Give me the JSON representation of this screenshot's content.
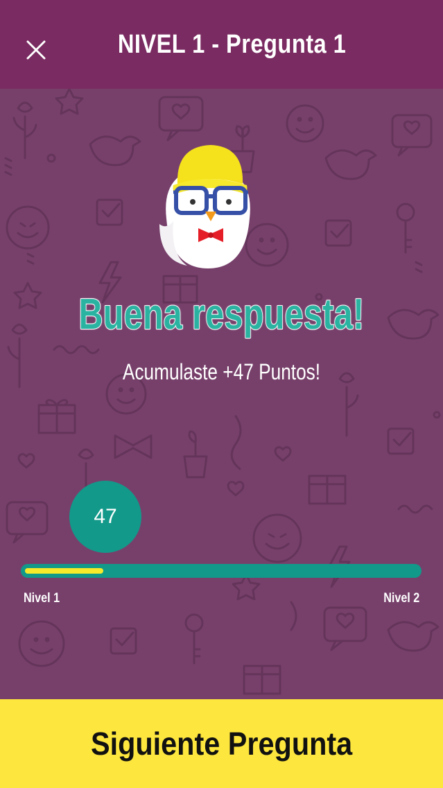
{
  "header": {
    "title": "NIVEL 1 - Pregunta 1",
    "close_icon": "close-icon"
  },
  "result": {
    "headline": "Buena respuesta!",
    "points_message": "Acumulaste +47 Puntos!",
    "mascot_icon": "chick-mascot-icon"
  },
  "progress": {
    "score": "47",
    "fill_fraction": 0.2,
    "current_level_label": "Nivel 1",
    "next_level_label": "Nivel 2"
  },
  "footer": {
    "next_button_label": "Siguiente Pregunta"
  },
  "colors": {
    "header_bg": "#7a2b61",
    "body_bg": "#77406b",
    "accent_teal": "#12998a",
    "accent_yellow": "#fde63d",
    "headline_teal": "#2bb3a1"
  }
}
